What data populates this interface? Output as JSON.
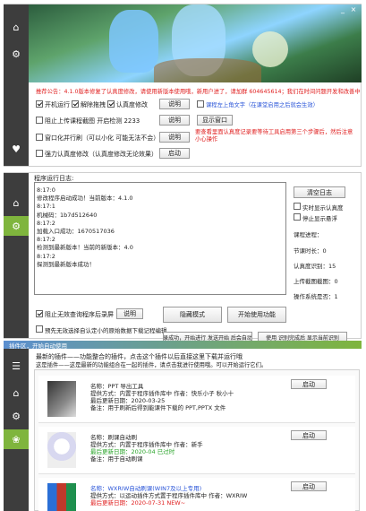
{
  "window1": {
    "notice": "推荐公告：4.1.0版本修复了认真度修改，请使用新版本使用哦，新用户进了，请加群 604645614；我们在时间问题开发和改善中",
    "options": {
      "auto_start": "开机运行",
      "enable_drag": "解除拖拽",
      "recognize_degree": "认真度修改",
      "upload_check": "阻止上传课程截图 开启检测 2233",
      "watch_window": "窗口化并行刷（可以小化 可能无法不会）",
      "force_cn": "强力认真度修改（认真度修改无论效果）",
      "desktop_text": "课程左上角文字（在课堂启用之后就会生效）"
    },
    "buttons": {
      "explain1": "说明",
      "explain2": "说明",
      "explain3": "说明",
      "show_window": "显示窗口",
      "startup_btn": "启动"
    },
    "red_note": "要查看里面认真度记录要等待工具启用第三个步骤后，然后注意小心操作",
    "colors": {
      "sidebar": "#3d3d3d",
      "accent": "#7fb53d",
      "notice_red": "#e02020"
    }
  },
  "window2": {
    "log_title": "程序运行日志:",
    "log_lines": [
      "8:17:0",
      "修改程序启动成功！当前版本：4.1.0",
      "8:17:1",
      "机械码：1b7d512640",
      "8:17:2",
      "加载入口成功：1670517036",
      "8:17:2",
      "检测到最新版本！当前的新版本：4.0",
      "8:17:2",
      "探测到最新版本成功！"
    ],
    "options": {
      "block_debug": "阻止无效查询程序后录屏",
      "preload": "预先无效选择自认定小的原始数据下载记程编辑"
    },
    "buttons": {
      "explain": "说明",
      "clear_log": "清空日志",
      "hide_mode": "隐藏模式",
      "open_features": "开始使用功能"
    },
    "right": {
      "show_realtime": "实时显示认真度",
      "float_window": "停止显示悬浮",
      "course_label": "课程进程：",
      "degree_label": "节课时长：0",
      "recognize_count": "认真度识别：15",
      "screenshot_count": "上传截图截图：0",
      "exec_count": "操作系统是否：1"
    },
    "bottom_left": "登录成功，开始进行 发送开始 后会自动刷",
    "bottom_right": "使用 识别完成后 显示当前识别"
  },
  "window3": {
    "header": "插件区，开始自动使用",
    "intro": "最新的插件——功能整合的插件，点击这个插件以后直接这里下载并运行哦",
    "intro2": "这是插件——这是最新的功能组合在一起的插件，请点击我进行使用哦。可以开始运行它们。",
    "plugins": [
      {
        "name": "名称：PPT 导出工具",
        "provider": "提供方式：内置于程序插件库中 作者：快乐小子 秋小十",
        "updated": "最后更新日期：2020-03-25",
        "desc": "备注：用于刷新后得到能课件下载的 PPT,PPTX 文件",
        "button": "启动",
        "thumb": "ppt"
      },
      {
        "name": "名称：刷课自动刷",
        "provider": "提供方式：内置于程序插件库中 作者：新手",
        "updated": "最后更新日期：2020-04 已过时",
        "desc": "备注：用于自动刷课",
        "button": "启动",
        "thumb": "anime"
      },
      {
        "name": "名称：WXRIW自动刷课(WIN7及以上专用)",
        "provider": "提供方式：以运动插件方式置于程序插件库中 作者：WXRIW",
        "updated": "最后更新日期：2020-07-31 NEW~",
        "desc": "",
        "button": "启动",
        "thumb": "office"
      }
    ]
  }
}
